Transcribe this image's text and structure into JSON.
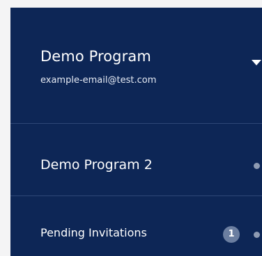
{
  "account": {
    "name": "Demo Program",
    "email": "example-email@test.com"
  },
  "menu": {
    "items": [
      {
        "label": "Demo Program 2"
      },
      {
        "label": "Pending Invitations",
        "badge": "1"
      }
    ]
  },
  "colors": {
    "panel_background": "#0d2656",
    "page_background": "#f4f4f5",
    "badge_background": "#6b7ea0",
    "status_dot": "#8e9bb3"
  },
  "icons": {
    "dropdown": "caret-down-icon",
    "status": "status-dot-icon"
  }
}
